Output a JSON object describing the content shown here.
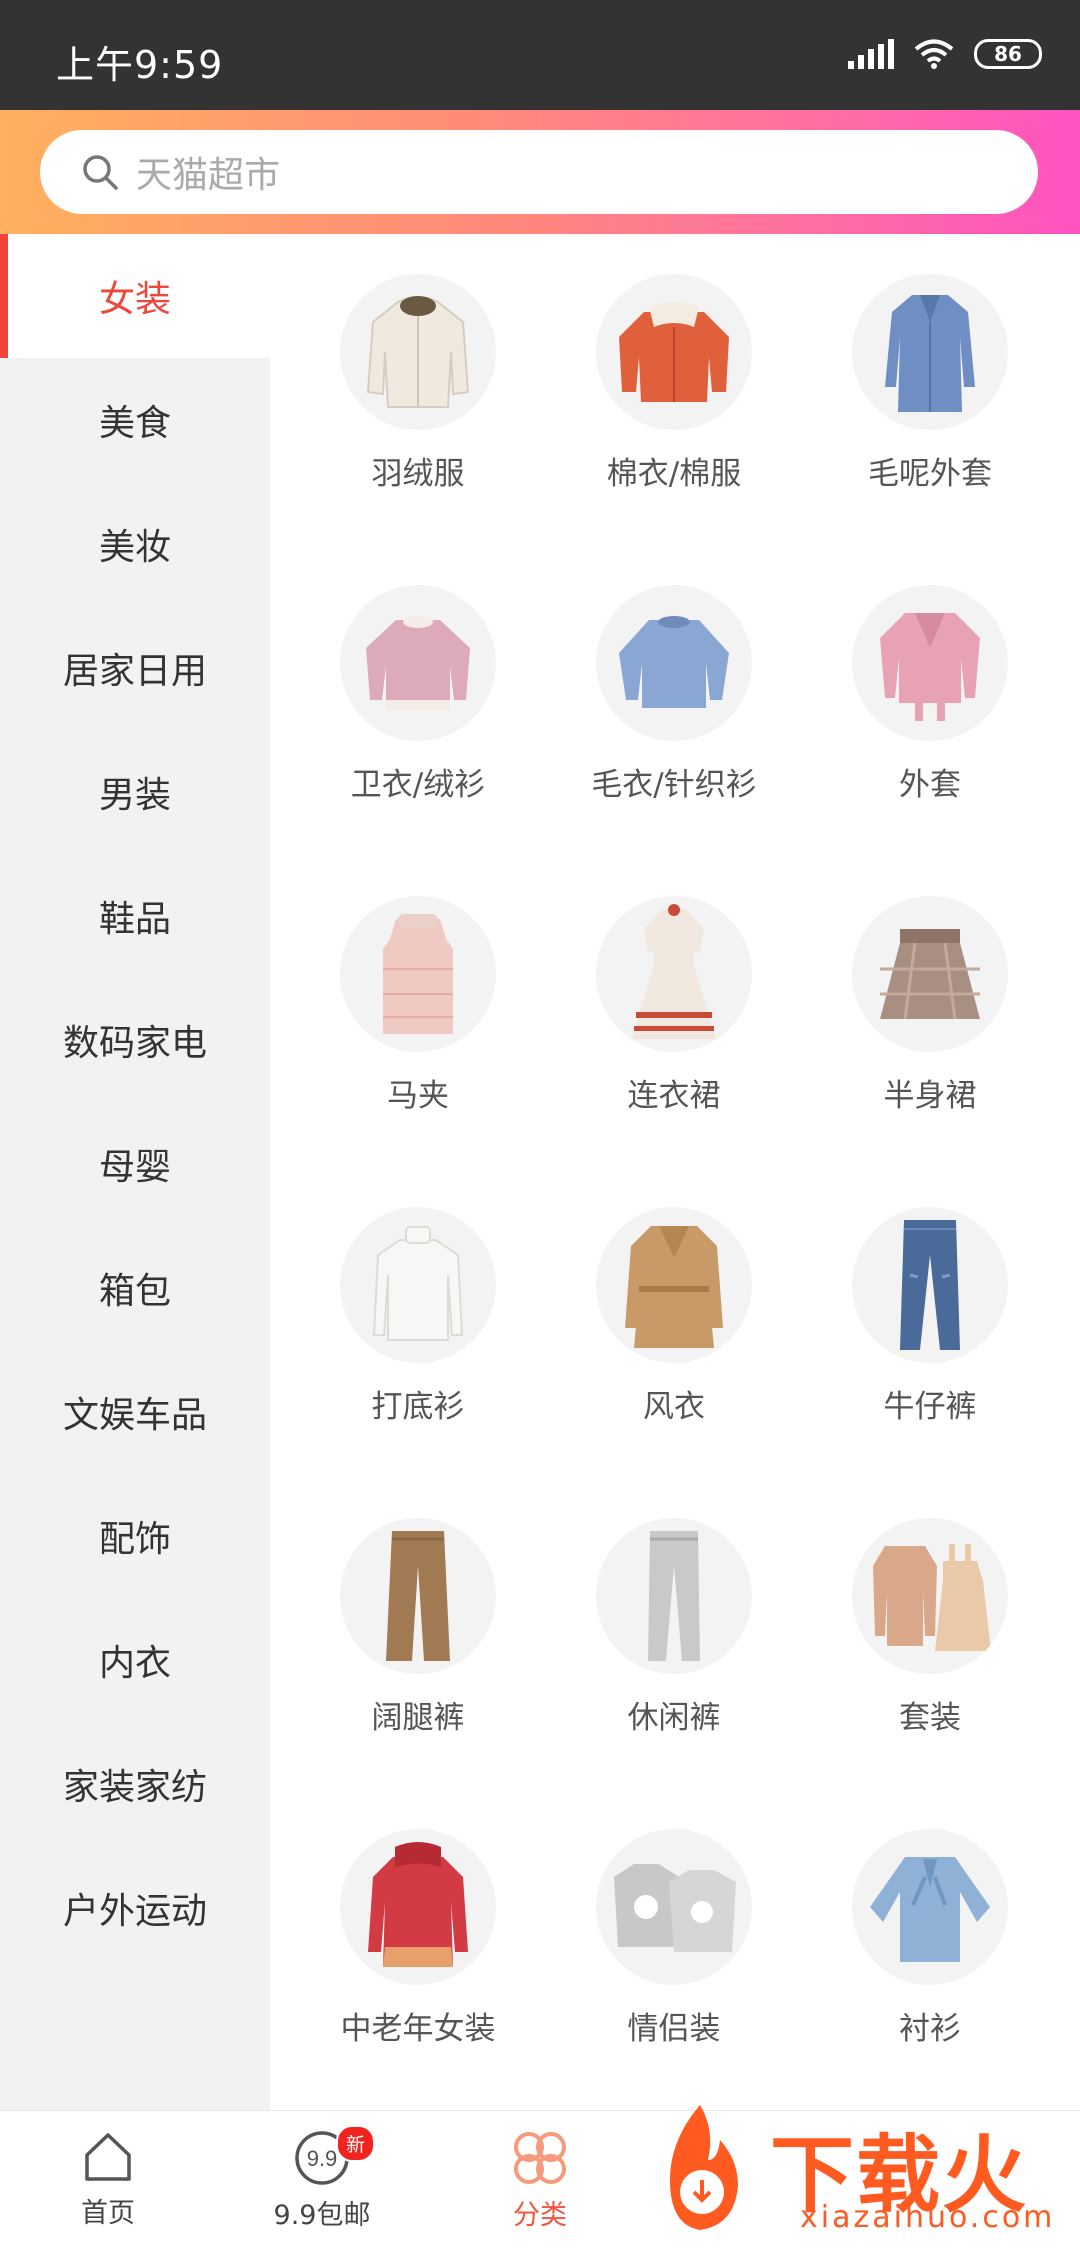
{
  "status_bar": {
    "time": "上午9:59",
    "battery": "86"
  },
  "search": {
    "placeholder": "天猫超市"
  },
  "sidebar": {
    "items": [
      {
        "label": "女装"
      },
      {
        "label": "美食"
      },
      {
        "label": "美妆"
      },
      {
        "label": "居家日用"
      },
      {
        "label": "男装"
      },
      {
        "label": "鞋品"
      },
      {
        "label": "数码家电"
      },
      {
        "label": "母婴"
      },
      {
        "label": "箱包"
      },
      {
        "label": "文娱车品"
      },
      {
        "label": "配饰"
      },
      {
        "label": "内衣"
      },
      {
        "label": "家装家纺"
      },
      {
        "label": "户外运动"
      }
    ]
  },
  "categories": [
    {
      "label": "羽绒服",
      "icon": "down-jacket-icon",
      "color": "#efe9e0"
    },
    {
      "label": "棉衣/棉服",
      "icon": "cotton-coat-icon",
      "color": "#e0603c"
    },
    {
      "label": "毛呢外套",
      "icon": "wool-coat-icon",
      "color": "#6f8fc4"
    },
    {
      "label": "卫衣/绒衫",
      "icon": "sweatshirt-icon",
      "color": "#dcaab8"
    },
    {
      "label": "毛衣/针织衫",
      "icon": "sweater-icon",
      "color": "#89a6d4"
    },
    {
      "label": "外套",
      "icon": "jacket-icon",
      "color": "#e7a3b4"
    },
    {
      "label": "马夹",
      "icon": "vest-icon",
      "color": "#f0c9c3"
    },
    {
      "label": "连衣裙",
      "icon": "dress-icon",
      "color": "#f1e8df"
    },
    {
      "label": "半身裙",
      "icon": "skirt-icon",
      "color": "#a88f82"
    },
    {
      "label": "打底衫",
      "icon": "base-shirt-icon",
      "color": "#f7f7f5"
    },
    {
      "label": "风衣",
      "icon": "trench-coat-icon",
      "color": "#c79a68"
    },
    {
      "label": "牛仔裤",
      "icon": "jeans-icon",
      "color": "#4a6a9a"
    },
    {
      "label": "阔腿裤",
      "icon": "wide-pants-icon",
      "color": "#a17a54"
    },
    {
      "label": "休闲裤",
      "icon": "casual-pants-icon",
      "color": "#c9c9c9"
    },
    {
      "label": "套装",
      "icon": "suit-set-icon",
      "color": "#d9a88a"
    },
    {
      "label": "中老年女装",
      "icon": "elder-coat-icon",
      "color": "#d33b44"
    },
    {
      "label": "情侣装",
      "icon": "couple-hoodie-icon",
      "color": "#c8c8c8"
    },
    {
      "label": "衬衫",
      "icon": "blouse-icon",
      "color": "#8fb1d6"
    }
  ],
  "tabbar": {
    "items": [
      {
        "label": "首页",
        "icon": "home-icon"
      },
      {
        "label": "9.9包邮",
        "icon": "nine-nine-icon",
        "badge": "新"
      },
      {
        "label": "分类",
        "icon": "category-icon"
      }
    ]
  },
  "watermark": {
    "text": "下载火",
    "sub": "xiazaihuo.com"
  }
}
